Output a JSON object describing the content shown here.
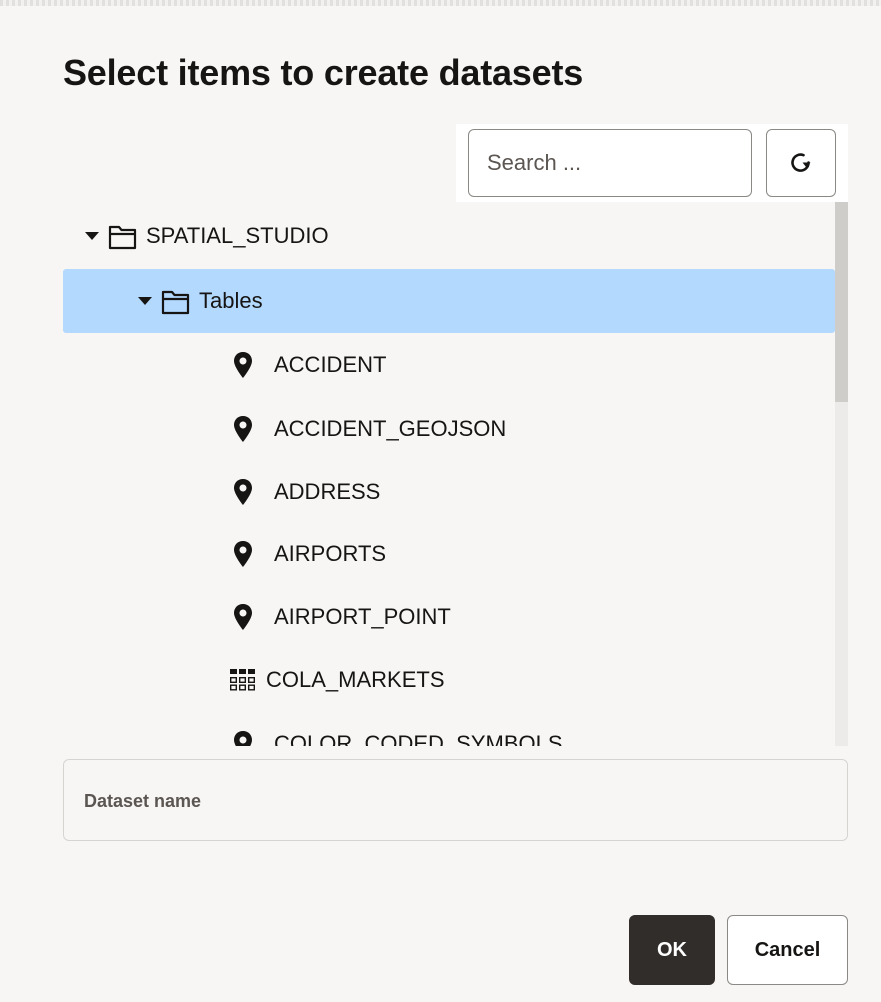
{
  "dialog": {
    "title": "Select items to create datasets"
  },
  "search": {
    "placeholder": "Search ..."
  },
  "refresh": {
    "icon": "refresh-icon"
  },
  "tree": {
    "root": {
      "label": "SPATIAL_STUDIO",
      "expanded": true,
      "icon": "folder-icon"
    },
    "folder": {
      "label": "Tables",
      "expanded": true,
      "selected": true,
      "icon": "folder-icon"
    },
    "items": [
      {
        "label": "ACCIDENT",
        "icon": "map-pin-icon"
      },
      {
        "label": "ACCIDENT_GEOJSON",
        "icon": "map-pin-icon"
      },
      {
        "label": "ADDRESS",
        "icon": "map-pin-icon"
      },
      {
        "label": "AIRPORTS",
        "icon": "map-pin-icon"
      },
      {
        "label": "AIRPORT_POINT",
        "icon": "map-pin-icon"
      },
      {
        "label": "COLA_MARKETS",
        "icon": "grid-icon"
      },
      {
        "label": "COLOR_CODED_SYMBOLS",
        "icon": "map-pin-icon"
      }
    ]
  },
  "dataset": {
    "label": "Dataset name",
    "value": ""
  },
  "buttons": {
    "ok": "OK",
    "cancel": "Cancel"
  },
  "colors": {
    "selected_row": "#b3d9ff",
    "primary_button": "#312d2a",
    "background": "#f7f6f5"
  }
}
